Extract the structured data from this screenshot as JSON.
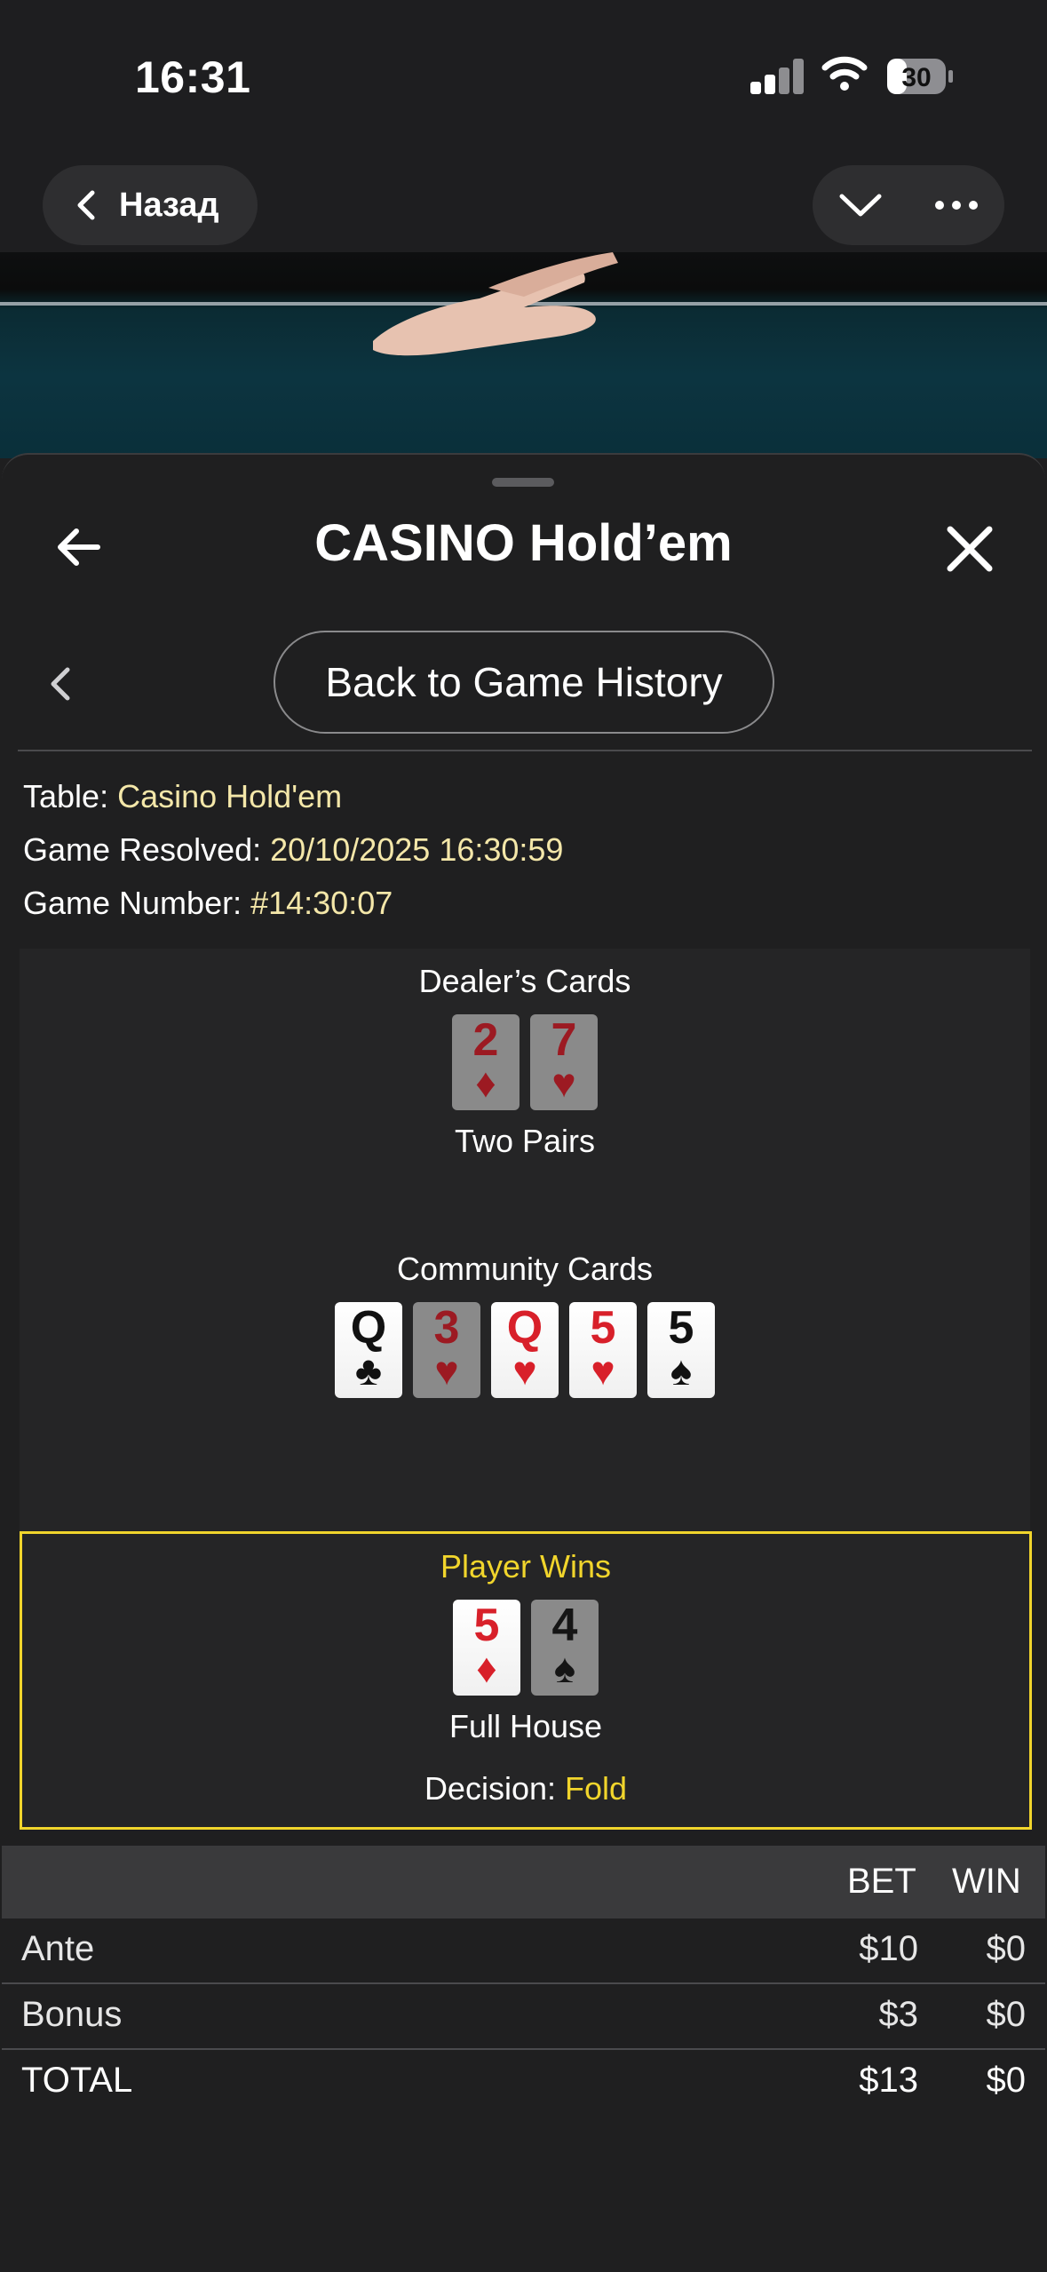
{
  "status": {
    "time": "16:31",
    "battery": "30"
  },
  "nav": {
    "back_label": "Назад"
  },
  "sheet": {
    "title": "CASINO Hold’em",
    "history_button": "Back to Game History"
  },
  "info": {
    "table_label": "Table:",
    "table_value": "Casino Hold'em",
    "resolved_label": "Game Resolved:",
    "resolved_value": "20/10/2025 16:30:59",
    "number_label": "Game Number:",
    "number_value": "#14:30:07"
  },
  "dealer": {
    "label": "Dealer’s Cards",
    "hand": "Two Pairs",
    "cards": [
      {
        "rank": "2",
        "suit": "♦",
        "color": "red",
        "dim": true
      },
      {
        "rank": "7",
        "suit": "♥",
        "color": "red",
        "dim": true
      }
    ]
  },
  "community": {
    "label": "Community Cards",
    "cards": [
      {
        "rank": "Q",
        "suit": "♣",
        "color": "blk",
        "dim": false
      },
      {
        "rank": "3",
        "suit": "♥",
        "color": "red",
        "dim": true
      },
      {
        "rank": "Q",
        "suit": "♥",
        "color": "red",
        "dim": false
      },
      {
        "rank": "5",
        "suit": "♥",
        "color": "red",
        "dim": false
      },
      {
        "rank": "5",
        "suit": "♠",
        "color": "blk",
        "dim": false
      }
    ]
  },
  "player": {
    "label": "Player Wins",
    "hand": "Full House",
    "decision_label": "Decision:",
    "decision_value": "Fold",
    "cards": [
      {
        "rank": "5",
        "suit": "♦",
        "color": "red",
        "dim": false
      },
      {
        "rank": "4",
        "suit": "♠",
        "color": "blk",
        "dim": true
      }
    ]
  },
  "bets": {
    "headers": {
      "bet": "BET",
      "win": "WIN"
    },
    "rows": [
      {
        "name": "Ante",
        "bet": "$10",
        "win": "$0"
      },
      {
        "name": "Bonus",
        "bet": "$3",
        "win": "$0"
      },
      {
        "name": "TOTAL",
        "bet": "$13",
        "win": "$0"
      }
    ]
  }
}
